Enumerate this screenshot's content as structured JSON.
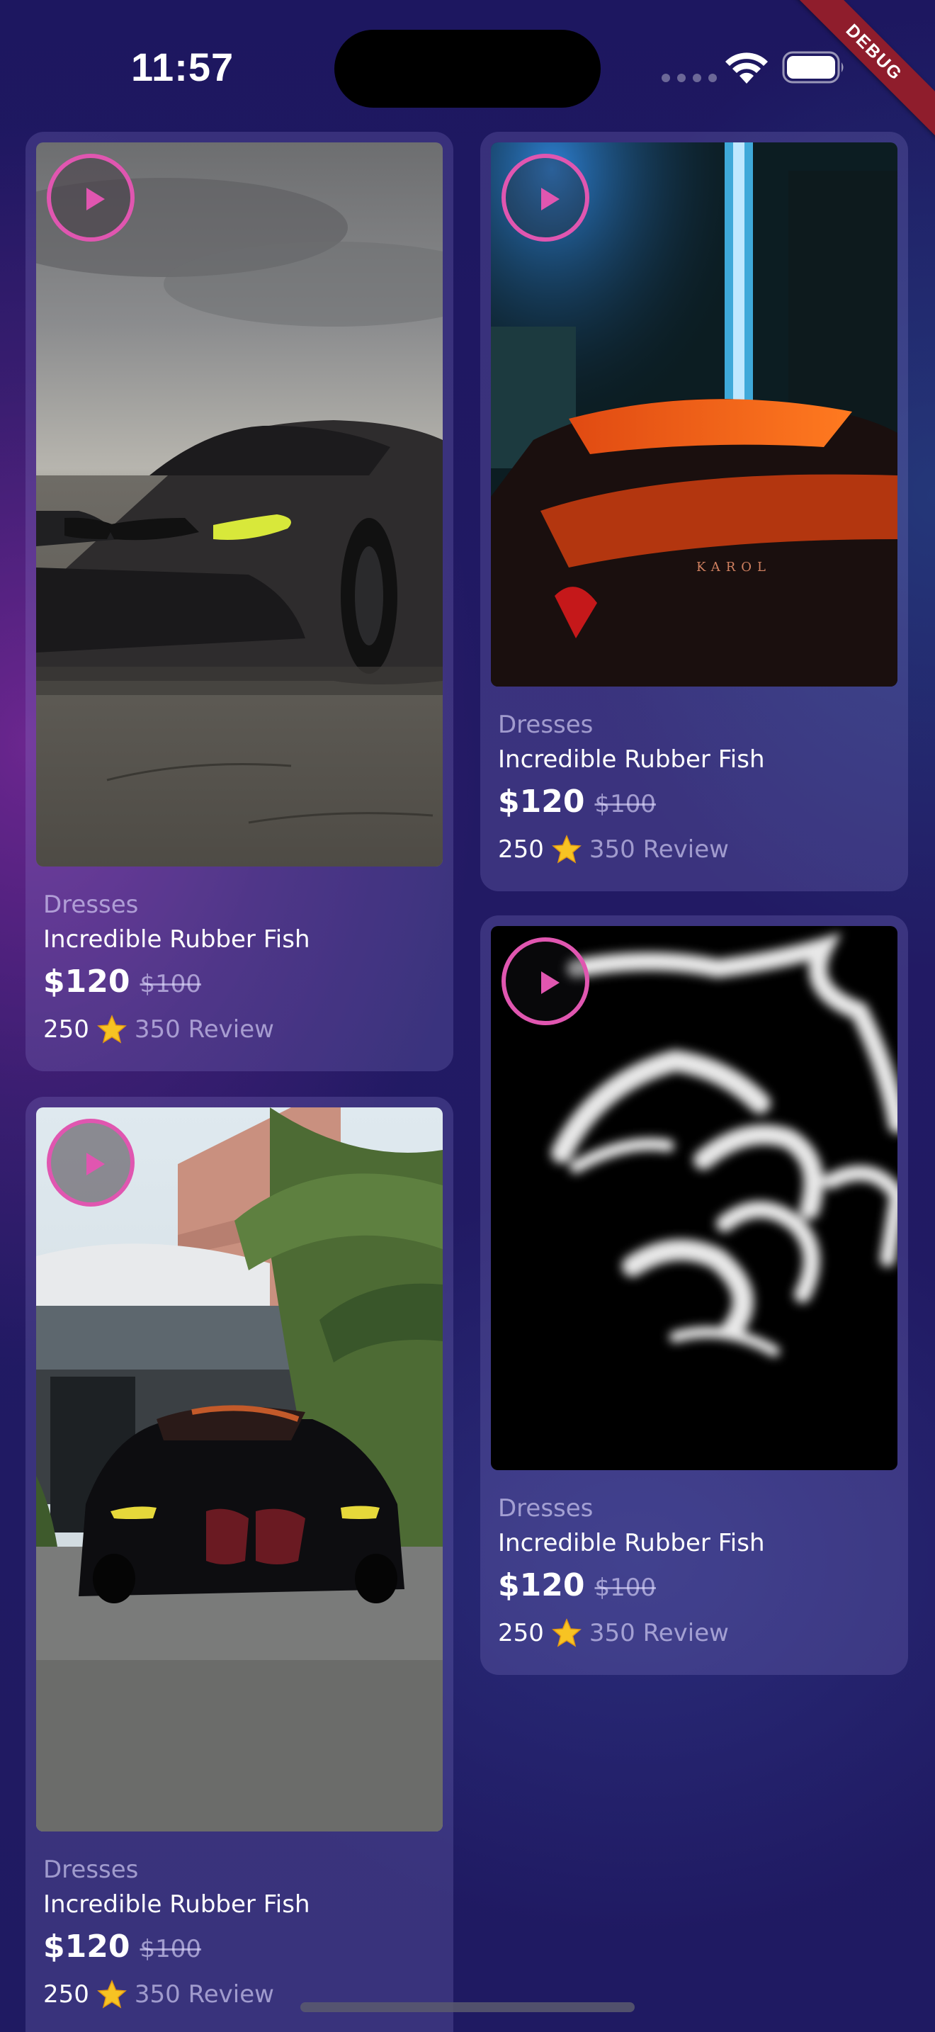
{
  "status_bar": {
    "time": "11:57",
    "debug_label": "DEBUG",
    "icons": [
      "signal-dots-icon",
      "wifi-icon",
      "battery-icon"
    ]
  },
  "colors": {
    "play_ring": "#e056b0",
    "card_bg": "rgba(150,140,220,0.22)",
    "star": "#f7c323"
  },
  "products": [
    {
      "category": "Dresses",
      "title": "Incredible Rubber Fish",
      "price": "$120",
      "old_price": "$100",
      "rating_count": "250",
      "review": "350 Review",
      "media": "gray-car-photo",
      "icon": "play-icon"
    },
    {
      "category": "Dresses",
      "title": "Incredible Rubber Fish",
      "price": "$120",
      "old_price": "$100",
      "rating_count": "250",
      "review": "350 Review",
      "media": "orange-spoiler-photo",
      "icon": "play-icon"
    },
    {
      "category": "Dresses",
      "title": "Incredible Rubber Fish",
      "price": "$120",
      "old_price": "$100",
      "rating_count": "250",
      "review": "350 Review",
      "media": "black-car-palm-photo",
      "icon": "play-icon"
    },
    {
      "category": "Dresses",
      "title": "Incredible Rubber Fish",
      "price": "$120",
      "old_price": "$100",
      "rating_count": "250",
      "review": "350 Review",
      "media": "glowing-logo-photo",
      "icon": "play-icon"
    }
  ]
}
